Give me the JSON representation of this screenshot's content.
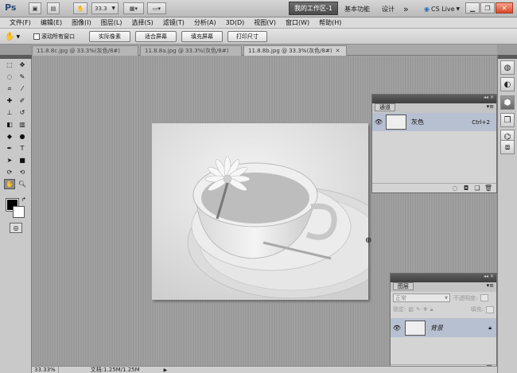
{
  "appbar": {
    "logo": "Ps",
    "zoom": "33.3",
    "workspace_active": "我的工作区-1",
    "workspace_basic": "基本功能",
    "workspace_design": "设计",
    "more": "»",
    "cslive": "CS Live"
  },
  "menubar": {
    "items": [
      "文件(F)",
      "编辑(E)",
      "图像(I)",
      "图层(L)",
      "选择(S)",
      "滤镜(T)",
      "分析(A)",
      "3D(D)",
      "视图(V)",
      "窗口(W)",
      "帮助(H)"
    ]
  },
  "options": {
    "scroll_all_label": "滚动所有窗口",
    "actual_pixels": "实际像素",
    "fit_screen": "适合屏幕",
    "fill_screen": "填充屏幕",
    "print_size": "打印尺寸"
  },
  "tabs": [
    {
      "label": "11.8.8c.jpg @ 33.3%(灰色/8#)"
    },
    {
      "label": "11.8.8a.jpg @ 33.3%(灰色/8#)"
    },
    {
      "label": "11.8.8b.jpg @ 33.3%(灰色/8#)"
    }
  ],
  "channels_panel": {
    "tab": "通道",
    "row_name": "灰色",
    "row_shortcut": "Ctrl+2"
  },
  "layers_panel": {
    "tab": "图层",
    "blend_mode": "正常",
    "opacity_label": "不透明度:",
    "lock_label": "锁定:",
    "fill_label": "填充:",
    "layer_name": "背景"
  },
  "status": {
    "zoom": "33.33%",
    "doc_info": "文档:1.25M/1.25M"
  },
  "colors": {
    "panel_bg": "#d4d4d4",
    "selected_row": "#b7c0d1",
    "workspace_active_bg": "#4a4a4a",
    "close_button": "#d9472a"
  }
}
